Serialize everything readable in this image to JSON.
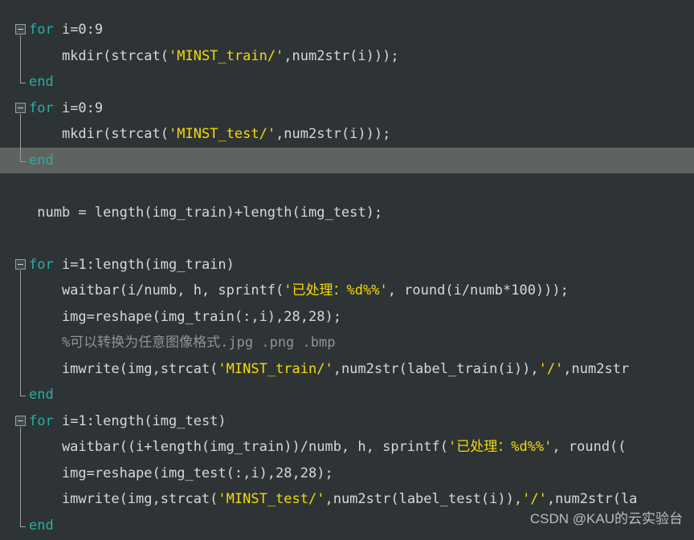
{
  "editor": {
    "app": "matlab-code-editor",
    "background_color": "#2e3436",
    "current_line_highlight_color": "#5e6360",
    "colors": {
      "keyword": "#23b0a6",
      "string": "#f5d90a",
      "comment": "#8d9490",
      "plain": "#d6d8d4",
      "fold_marker": "#9aa09c"
    }
  },
  "lines": [
    {
      "index": 0,
      "indent": 0,
      "fold": "open",
      "tokens": [
        {
          "t": "for",
          "c": "kw"
        },
        {
          "t": " i=0:9",
          "c": "pln"
        }
      ]
    },
    {
      "index": 1,
      "indent": 1,
      "tokens": [
        {
          "t": "    mkdir(strcat(",
          "c": "pln"
        },
        {
          "t": "'MINST_train/'",
          "c": "str"
        },
        {
          "t": ",num2str(i)));",
          "c": "pln"
        }
      ]
    },
    {
      "index": 2,
      "indent": 0,
      "fold": "end",
      "tokens": [
        {
          "t": "end",
          "c": "kw"
        }
      ]
    },
    {
      "index": 3,
      "indent": 0,
      "fold": "open",
      "tokens": [
        {
          "t": "for",
          "c": "kw"
        },
        {
          "t": " i=0:9",
          "c": "pln"
        }
      ]
    },
    {
      "index": 4,
      "indent": 1,
      "tokens": [
        {
          "t": "    mkdir(strcat(",
          "c": "pln"
        },
        {
          "t": "'MINST_test/'",
          "c": "str"
        },
        {
          "t": ",num2str(i)));",
          "c": "pln"
        }
      ]
    },
    {
      "index": 5,
      "indent": 0,
      "fold": "end",
      "current": true,
      "tokens": [
        {
          "t": "end",
          "c": "kw"
        }
      ]
    },
    {
      "index": 6,
      "indent": 0,
      "tokens": []
    },
    {
      "index": 7,
      "indent": 0,
      "tokens": [
        {
          "t": " numb = length(img_train)+length(img_test);",
          "c": "pln"
        }
      ]
    },
    {
      "index": 8,
      "indent": 0,
      "tokens": []
    },
    {
      "index": 9,
      "indent": 0,
      "fold": "open",
      "tokens": [
        {
          "t": "for",
          "c": "kw"
        },
        {
          "t": " i=1:length(img_train)",
          "c": "pln"
        }
      ]
    },
    {
      "index": 10,
      "indent": 1,
      "tokens": [
        {
          "t": "    waitbar(i/numb, h, sprintf(",
          "c": "pln"
        },
        {
          "t": "'已处理：%d%%'",
          "c": "str"
        },
        {
          "t": ", round(i/numb*100)));",
          "c": "pln"
        }
      ]
    },
    {
      "index": 11,
      "indent": 1,
      "tokens": [
        {
          "t": "    img=reshape(img_train(:,i),28,28);",
          "c": "pln"
        }
      ]
    },
    {
      "index": 12,
      "indent": 1,
      "tokens": [
        {
          "t": "    %可以转换为任意图像格式.jpg .png .bmp",
          "c": "cmt"
        }
      ]
    },
    {
      "index": 13,
      "indent": 1,
      "tokens": [
        {
          "t": "    imwrite(img,strcat(",
          "c": "pln"
        },
        {
          "t": "'MINST_train/'",
          "c": "str"
        },
        {
          "t": ",num2str(label_train(i)),",
          "c": "pln"
        },
        {
          "t": "'/'",
          "c": "str"
        },
        {
          "t": ",num2str",
          "c": "pln"
        }
      ]
    },
    {
      "index": 14,
      "indent": 0,
      "fold": "end",
      "tokens": [
        {
          "t": "end",
          "c": "kw"
        }
      ]
    },
    {
      "index": 15,
      "indent": 0,
      "fold": "open",
      "tokens": [
        {
          "t": "for",
          "c": "kw"
        },
        {
          "t": " i=1:length(img_test)",
          "c": "pln"
        }
      ]
    },
    {
      "index": 16,
      "indent": 1,
      "tokens": [
        {
          "t": "    waitbar((i+length(img_train))/numb, h, sprintf(",
          "c": "pln"
        },
        {
          "t": "'已处理：%d%%'",
          "c": "str"
        },
        {
          "t": ", round((",
          "c": "pln"
        }
      ]
    },
    {
      "index": 17,
      "indent": 1,
      "tokens": [
        {
          "t": "    img=reshape(img_test(:,i),28,28);",
          "c": "pln"
        }
      ]
    },
    {
      "index": 18,
      "indent": 1,
      "tokens": [
        {
          "t": "    imwrite(img,strcat(",
          "c": "pln"
        },
        {
          "t": "'MINST_test/'",
          "c": "str"
        },
        {
          "t": ",num2str(label_test(i)),",
          "c": "pln"
        },
        {
          "t": "'/'",
          "c": "str"
        },
        {
          "t": ",num2str(la",
          "c": "pln"
        }
      ]
    },
    {
      "index": 19,
      "indent": 0,
      "fold": "end",
      "tokens": [
        {
          "t": "end",
          "c": "kw"
        }
      ]
    }
  ],
  "fold_groups": [
    {
      "start": 0,
      "end": 2
    },
    {
      "start": 3,
      "end": 5
    },
    {
      "start": 9,
      "end": 14
    },
    {
      "start": 15,
      "end": 19
    }
  ],
  "watermark": {
    "text": "CSDN @KAU的云实验台"
  }
}
